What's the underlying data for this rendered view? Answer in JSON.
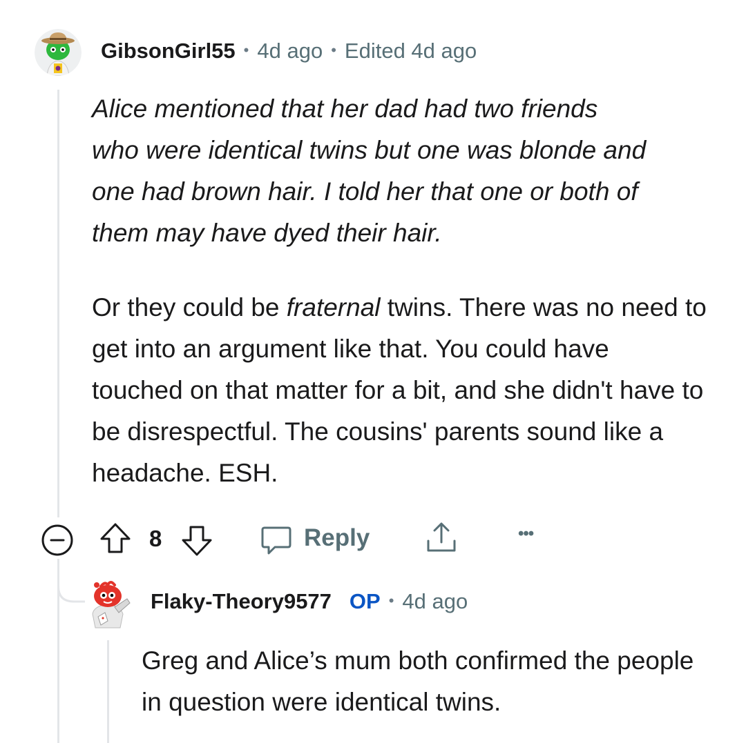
{
  "parent_comment": {
    "author": "GibsonGirl55",
    "age": "4d ago",
    "edited": "Edited 4d ago",
    "body": {
      "quote_lines": [
        "Alice mentioned that her dad had two friends",
        "who were identical twins but one was blonde and",
        "one had brown hair. I told her that one or both of",
        "them may have dyed their hair."
      ],
      "para2_before": "Or they could be ",
      "para2_em": "fraternal",
      "para2_after": " twins. There was no need to get into an argument like that. You could have touched on that matter for a bit, and she didn't have to be disrespectful. The cousins' parents sound like a headache. ESH."
    },
    "score": "8",
    "reply_label": "Reply",
    "more_label": "•••"
  },
  "reply_comment": {
    "author": "Flaky-Theory9577",
    "op_label": "OP",
    "age": "4d ago",
    "body": "Greg and Alice’s mum both confirmed the people in question were identical twins."
  },
  "icons": {
    "collapse": "collapse-minus-icon",
    "upvote": "upvote-arrow-icon",
    "downvote": "downvote-arrow-icon",
    "reply": "speech-bubble-icon",
    "share": "share-upload-icon",
    "more": "more-dots-icon"
  },
  "colors": {
    "username": "#1a1a1b",
    "meta": "#576f76",
    "op": "#0a55c4",
    "thread_line": "#e3e5e8"
  }
}
